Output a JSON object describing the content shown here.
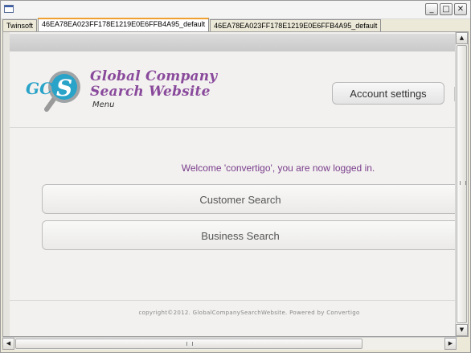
{
  "window": {
    "controls": {
      "minimize": "_",
      "maximize": "□",
      "close": "✕"
    }
  },
  "tabs": [
    {
      "label": "Twinsoft"
    },
    {
      "label": "46EA78EA023FF178E1219E0E6FFB4A95_default"
    },
    {
      "label": "46EA78EA023FF178E1219E0E6FFB4A95_default"
    }
  ],
  "header": {
    "logo_mark": "GC S",
    "brand_line1": "Global Company",
    "brand_line2": "Search Website",
    "menu_label": "Menu",
    "account_button": "Account settings"
  },
  "main": {
    "welcome": "Welcome 'convertigo', you are now logged in.",
    "customer_search": "Customer Search",
    "business_search": "Business Search"
  },
  "footer": {
    "copyright": "copyright©2012. GlobalCompanySearchWebsite. Powered by Convertigo"
  },
  "scrollbar": {
    "up": "▲",
    "down": "▼",
    "left": "◀",
    "right": "▶"
  },
  "colors": {
    "brand": "#8a4a9c",
    "logo_circle": "#2aa3c8",
    "welcome_text": "#7a3d8c",
    "active_tab_accent": "#f0a030"
  }
}
